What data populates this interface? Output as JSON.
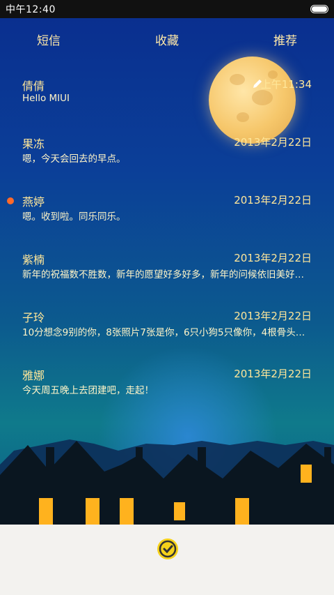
{
  "status_bar": {
    "time": "中午12:40"
  },
  "tabs": [
    {
      "label": "短信"
    },
    {
      "label": "收藏"
    },
    {
      "label": "推荐"
    }
  ],
  "conversations": [
    {
      "name": "倩倩",
      "date": "上午11:34",
      "preview": "Hello MIUI",
      "unread": false
    },
    {
      "name": "果冻",
      "date": "2013年2月22日",
      "preview": "嗯，今天会回去的早点。",
      "unread": false
    },
    {
      "name": "燕婷",
      "date": "2013年2月22日",
      "preview": "嗯。收到啦。同乐同乐。",
      "unread": true
    },
    {
      "name": "紫楠",
      "date": "2013年2月22日",
      "preview": "新年的祝福数不胜数，新年的愿望好多好多，新年的问候依旧美好…",
      "unread": false
    },
    {
      "name": "子玲",
      "date": "2013年2月22日",
      "preview": "10分想念9别的你，8张照片7张是你，6只小狗5只像你，4根骨头…",
      "unread": false
    },
    {
      "name": "雅娜",
      "date": "2013年2月22日",
      "preview": "今天周五晚上去团建吧，走起！",
      "unread": false
    }
  ],
  "icons": {
    "compose": "pencil-icon",
    "new_message": "new-message-icon",
    "battery": "battery-icon"
  },
  "colors": {
    "accent_text": "#ffe79a",
    "unread_dot": "#ff6a2a",
    "bottom_bar": "#f3f2ef"
  }
}
